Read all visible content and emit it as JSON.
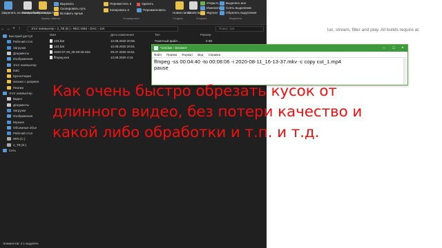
{
  "explorer": {
    "ribbon": {
      "clipboard_items": [
        "Закрепить на панели быстрого доступа",
        "Копировать",
        "Вставить"
      ],
      "clipboard_small": [
        "Вырезать",
        "Скопировать путь",
        "Вставить ярлык"
      ],
      "group_labels": [
        "Буфер обмена",
        "Упорядочить",
        "Создать",
        "Открыть",
        "Выделить"
      ],
      "organize_items": [
        "Переместить в",
        "Копировать в"
      ],
      "delete_rename": [
        "Удалить",
        "Переименовать"
      ],
      "new_folder": "Новая папка",
      "properties": "Свойства",
      "open_small": [
        "Открыть",
        "Изменить",
        "Журнал"
      ],
      "select_items": [
        "Выделить все",
        "Снять выделение",
        "Обратить выделение"
      ]
    },
    "address": {
      "path": "Этот компьютер  ›  2_TB (E:)  ›  REC-OBS  ›  DAC  ›  124",
      "search_placeholder": "Поиск: 124"
    },
    "nav_items": [
      "Быстрый доступ",
      "Рабочий стол",
      "Загрузки",
      "Документы",
      "Изображения",
      "Этот компьютер",
      "D&C",
      "Бухгалтерия",
      "письмо с докумен",
      "Пвонки",
      "Этот компьютер",
      "Видео",
      "Документы",
      "Загрузки",
      "Изображения",
      "Музыка",
      "Объемные объе",
      "Рабочий стол",
      "WIN (C:)",
      "2_TB (E:)",
      "Сеть"
    ],
    "columns": [
      "Имя",
      "Дата изменения",
      "Тип",
      "Размер"
    ],
    "files": [
      {
        "name": "123.bat",
        "date": "12.08.2020 20:55",
        "type": "Пакетный файл ...",
        "size": "0 КБ"
      },
      {
        "name": "124.bat",
        "date": "12.08.2020 20:51",
        "type": "Пакетный файл ...",
        "size": "1 КБ"
      },
      {
        "name": "2020-07-29_05-08-28.mkv",
        "date": "29.07.2020 18:51",
        "type": "",
        "size": ""
      },
      {
        "name": "ffmpeg.exe",
        "date": "12.08.2020 4:15",
        "type": "",
        "size": ""
      }
    ],
    "status": "Элементов: 4   1 выделен"
  },
  "background_text": "lux, stream, filter and play. All builds require at",
  "notepad": {
    "title": "*123.bat – Блокнот",
    "menu": [
      "Файл",
      "Правка",
      "Формат",
      "Вид",
      "Справка"
    ],
    "lines": [
      "ffmpeg -ss 00:04:40 -to 00:08:06 -i 2020-08-11_16-13-37.mkv -c copy cut_1.mp4",
      "pause"
    ]
  },
  "caption": [
    "Как очень быстро обрезать кусок от",
    "длинного видео, без потери качество и",
    "какой либо обработки и т.п. и т.д."
  ],
  "colors": {
    "explorer_bg": "#202020",
    "notepad_titlebar": "#3c9a3c",
    "caption": "#ee1111"
  }
}
